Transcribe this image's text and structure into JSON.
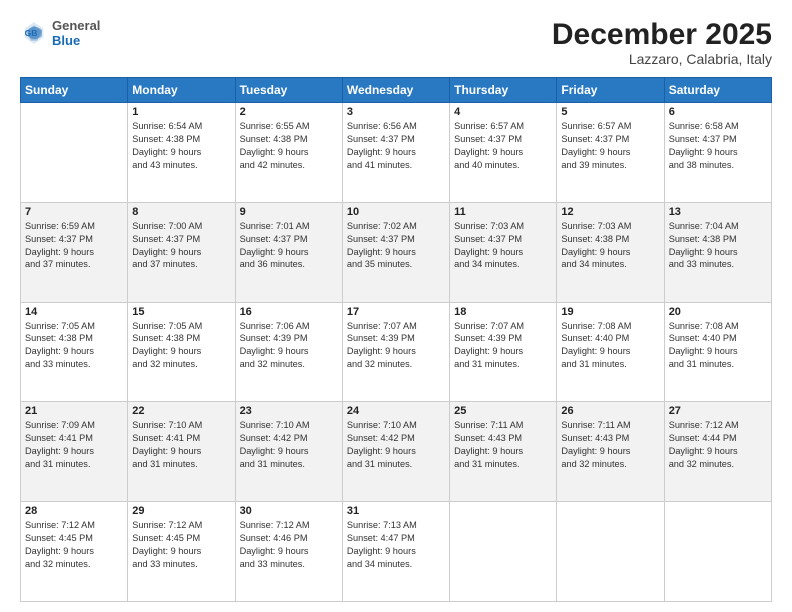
{
  "header": {
    "logo_general": "General",
    "logo_blue": "Blue",
    "month": "December 2025",
    "location": "Lazzaro, Calabria, Italy"
  },
  "weekdays": [
    "Sunday",
    "Monday",
    "Tuesday",
    "Wednesday",
    "Thursday",
    "Friday",
    "Saturday"
  ],
  "weeks": [
    [
      {
        "day": "",
        "lines": []
      },
      {
        "day": "1",
        "lines": [
          "Sunrise: 6:54 AM",
          "Sunset: 4:38 PM",
          "Daylight: 9 hours",
          "and 43 minutes."
        ]
      },
      {
        "day": "2",
        "lines": [
          "Sunrise: 6:55 AM",
          "Sunset: 4:38 PM",
          "Daylight: 9 hours",
          "and 42 minutes."
        ]
      },
      {
        "day": "3",
        "lines": [
          "Sunrise: 6:56 AM",
          "Sunset: 4:37 PM",
          "Daylight: 9 hours",
          "and 41 minutes."
        ]
      },
      {
        "day": "4",
        "lines": [
          "Sunrise: 6:57 AM",
          "Sunset: 4:37 PM",
          "Daylight: 9 hours",
          "and 40 minutes."
        ]
      },
      {
        "day": "5",
        "lines": [
          "Sunrise: 6:57 AM",
          "Sunset: 4:37 PM",
          "Daylight: 9 hours",
          "and 39 minutes."
        ]
      },
      {
        "day": "6",
        "lines": [
          "Sunrise: 6:58 AM",
          "Sunset: 4:37 PM",
          "Daylight: 9 hours",
          "and 38 minutes."
        ]
      }
    ],
    [
      {
        "day": "7",
        "lines": [
          "Sunrise: 6:59 AM",
          "Sunset: 4:37 PM",
          "Daylight: 9 hours",
          "and 37 minutes."
        ]
      },
      {
        "day": "8",
        "lines": [
          "Sunrise: 7:00 AM",
          "Sunset: 4:37 PM",
          "Daylight: 9 hours",
          "and 37 minutes."
        ]
      },
      {
        "day": "9",
        "lines": [
          "Sunrise: 7:01 AM",
          "Sunset: 4:37 PM",
          "Daylight: 9 hours",
          "and 36 minutes."
        ]
      },
      {
        "day": "10",
        "lines": [
          "Sunrise: 7:02 AM",
          "Sunset: 4:37 PM",
          "Daylight: 9 hours",
          "and 35 minutes."
        ]
      },
      {
        "day": "11",
        "lines": [
          "Sunrise: 7:03 AM",
          "Sunset: 4:37 PM",
          "Daylight: 9 hours",
          "and 34 minutes."
        ]
      },
      {
        "day": "12",
        "lines": [
          "Sunrise: 7:03 AM",
          "Sunset: 4:38 PM",
          "Daylight: 9 hours",
          "and 34 minutes."
        ]
      },
      {
        "day": "13",
        "lines": [
          "Sunrise: 7:04 AM",
          "Sunset: 4:38 PM",
          "Daylight: 9 hours",
          "and 33 minutes."
        ]
      }
    ],
    [
      {
        "day": "14",
        "lines": [
          "Sunrise: 7:05 AM",
          "Sunset: 4:38 PM",
          "Daylight: 9 hours",
          "and 33 minutes."
        ]
      },
      {
        "day": "15",
        "lines": [
          "Sunrise: 7:05 AM",
          "Sunset: 4:38 PM",
          "Daylight: 9 hours",
          "and 32 minutes."
        ]
      },
      {
        "day": "16",
        "lines": [
          "Sunrise: 7:06 AM",
          "Sunset: 4:39 PM",
          "Daylight: 9 hours",
          "and 32 minutes."
        ]
      },
      {
        "day": "17",
        "lines": [
          "Sunrise: 7:07 AM",
          "Sunset: 4:39 PM",
          "Daylight: 9 hours",
          "and 32 minutes."
        ]
      },
      {
        "day": "18",
        "lines": [
          "Sunrise: 7:07 AM",
          "Sunset: 4:39 PM",
          "Daylight: 9 hours",
          "and 31 minutes."
        ]
      },
      {
        "day": "19",
        "lines": [
          "Sunrise: 7:08 AM",
          "Sunset: 4:40 PM",
          "Daylight: 9 hours",
          "and 31 minutes."
        ]
      },
      {
        "day": "20",
        "lines": [
          "Sunrise: 7:08 AM",
          "Sunset: 4:40 PM",
          "Daylight: 9 hours",
          "and 31 minutes."
        ]
      }
    ],
    [
      {
        "day": "21",
        "lines": [
          "Sunrise: 7:09 AM",
          "Sunset: 4:41 PM",
          "Daylight: 9 hours",
          "and 31 minutes."
        ]
      },
      {
        "day": "22",
        "lines": [
          "Sunrise: 7:10 AM",
          "Sunset: 4:41 PM",
          "Daylight: 9 hours",
          "and 31 minutes."
        ]
      },
      {
        "day": "23",
        "lines": [
          "Sunrise: 7:10 AM",
          "Sunset: 4:42 PM",
          "Daylight: 9 hours",
          "and 31 minutes."
        ]
      },
      {
        "day": "24",
        "lines": [
          "Sunrise: 7:10 AM",
          "Sunset: 4:42 PM",
          "Daylight: 9 hours",
          "and 31 minutes."
        ]
      },
      {
        "day": "25",
        "lines": [
          "Sunrise: 7:11 AM",
          "Sunset: 4:43 PM",
          "Daylight: 9 hours",
          "and 31 minutes."
        ]
      },
      {
        "day": "26",
        "lines": [
          "Sunrise: 7:11 AM",
          "Sunset: 4:43 PM",
          "Daylight: 9 hours",
          "and 32 minutes."
        ]
      },
      {
        "day": "27",
        "lines": [
          "Sunrise: 7:12 AM",
          "Sunset: 4:44 PM",
          "Daylight: 9 hours",
          "and 32 minutes."
        ]
      }
    ],
    [
      {
        "day": "28",
        "lines": [
          "Sunrise: 7:12 AM",
          "Sunset: 4:45 PM",
          "Daylight: 9 hours",
          "and 32 minutes."
        ]
      },
      {
        "day": "29",
        "lines": [
          "Sunrise: 7:12 AM",
          "Sunset: 4:45 PM",
          "Daylight: 9 hours",
          "and 33 minutes."
        ]
      },
      {
        "day": "30",
        "lines": [
          "Sunrise: 7:12 AM",
          "Sunset: 4:46 PM",
          "Daylight: 9 hours",
          "and 33 minutes."
        ]
      },
      {
        "day": "31",
        "lines": [
          "Sunrise: 7:13 AM",
          "Sunset: 4:47 PM",
          "Daylight: 9 hours",
          "and 34 minutes."
        ]
      },
      {
        "day": "",
        "lines": []
      },
      {
        "day": "",
        "lines": []
      },
      {
        "day": "",
        "lines": []
      }
    ]
  ]
}
